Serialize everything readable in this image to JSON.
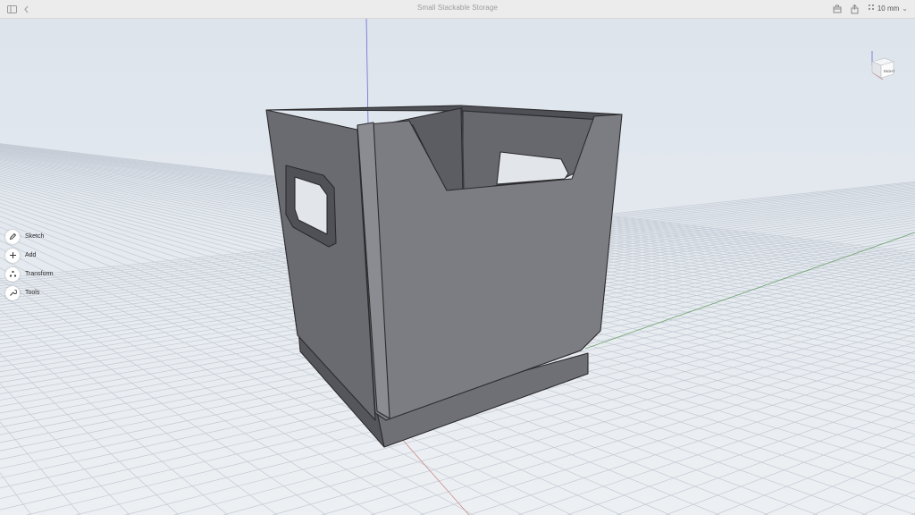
{
  "window": {
    "title": "Small Stackable Storage",
    "zoom_level": "10 mm",
    "zoom_chevron": "⌄"
  },
  "icons": {
    "sidebar_toggle": "sidebar-icon",
    "back": "chevron-left-icon",
    "export": "box-export-icon",
    "share": "share-icon",
    "grid": "grid-dots-icon"
  },
  "toolbar": {
    "items": [
      {
        "label": "Sketch",
        "icon": "pencil-icon"
      },
      {
        "label": "Add",
        "icon": "plus-icon"
      },
      {
        "label": "Transform",
        "icon": "transform-icon"
      },
      {
        "label": "Tools",
        "icon": "wrench-icon"
      }
    ]
  },
  "viewcube": {
    "face_label": "RIGHT"
  },
  "colors": {
    "background": "#e9edf1",
    "grid_line": "#c6ccd6",
    "axis_z": "#6a6ad8",
    "axis_y": "#6fa36f",
    "axis_x": "#c98a8a",
    "model_front": "#7c7d83",
    "model_side": "#67686e",
    "model_interior": "#5e5f65"
  }
}
